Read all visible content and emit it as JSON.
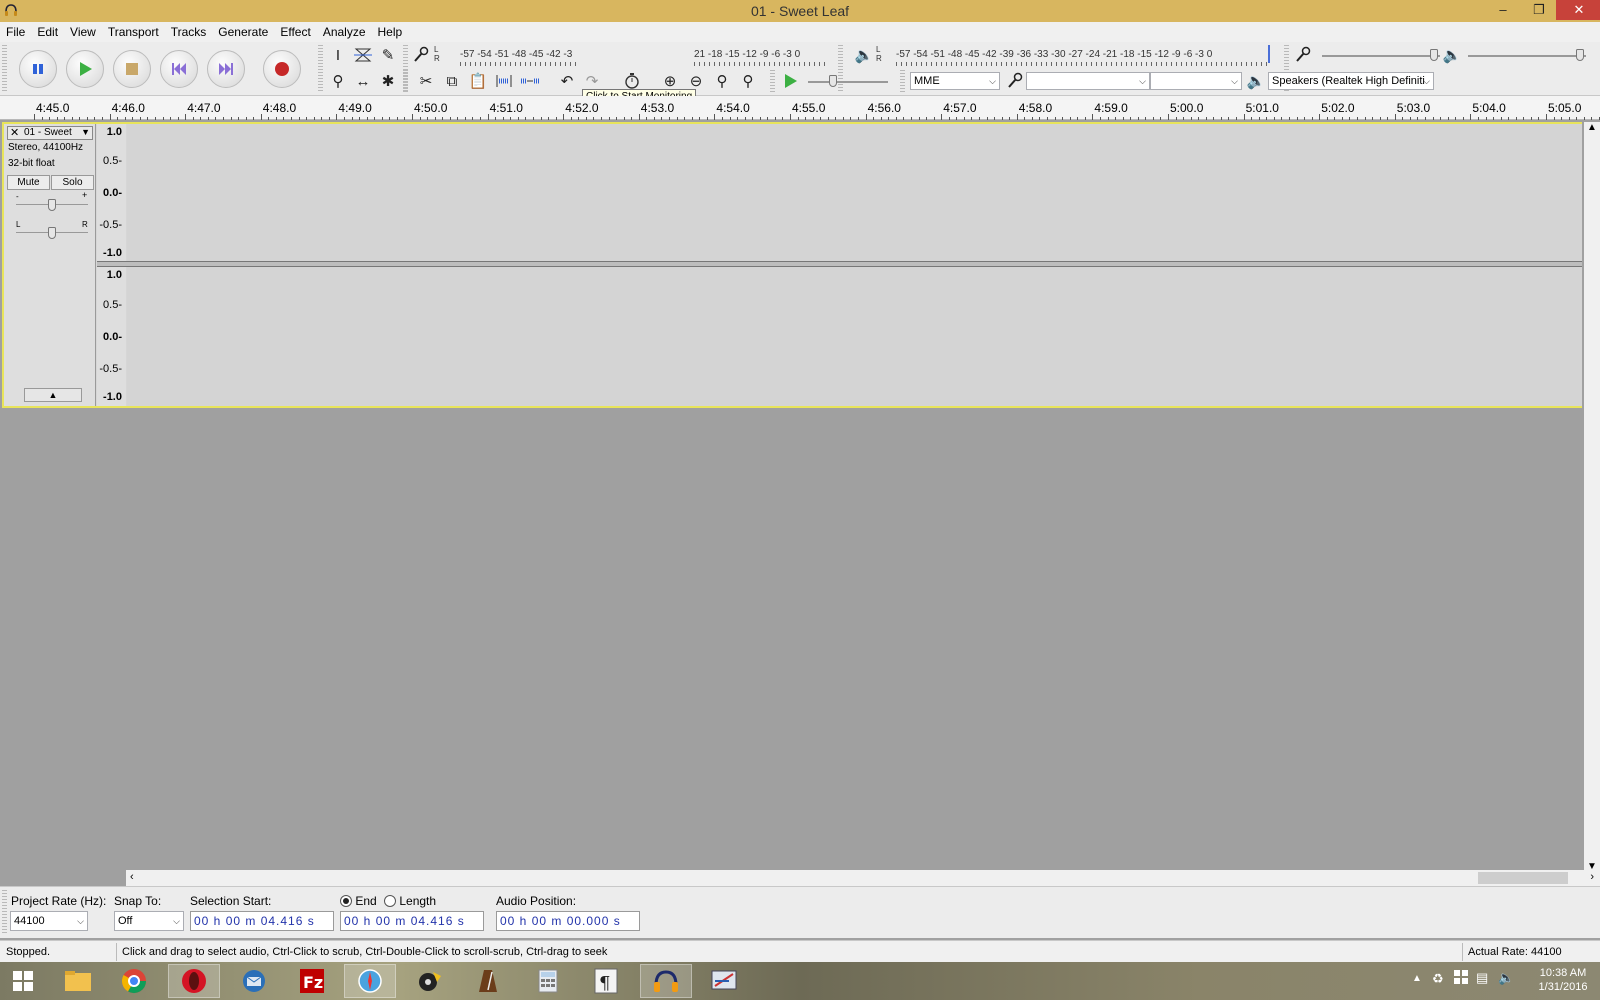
{
  "window": {
    "title": "01 - Sweet Leaf",
    "minimize": "–",
    "restore": "❐",
    "close": "✕"
  },
  "menu": [
    "File",
    "Edit",
    "View",
    "Transport",
    "Tracks",
    "Generate",
    "Effect",
    "Analyze",
    "Help"
  ],
  "meters": {
    "record_scale": "-57 -54 -51 -48 -45 -42 -3",
    "record_scale_right": "21 -18 -15 -12 -9 -6 -3 0",
    "record_lr": "L\nR",
    "tooltip": "Click to Start Monitoring",
    "playback_scale": "-57 -54 -51 -48 -45 -42 -39 -36 -33 -30 -27 -24 -21 -18 -15 -12 -9 -6 -3 0",
    "playback_lr": "L\nR"
  },
  "device": {
    "host": "MME",
    "input_device": "",
    "input_channels": "",
    "output_device": "Speakers (Realtek High Definiti"
  },
  "ruler": {
    "labels": [
      "4:45.0",
      "4:46.0",
      "4:47.0",
      "4:48.0",
      "4:49.0",
      "4:50.0",
      "4:51.0",
      "4:52.0",
      "4:53.0",
      "4:54.0",
      "4:55.0",
      "4:56.0",
      "4:57.0",
      "4:58.0",
      "4:59.0",
      "5:00.0",
      "5:01.0",
      "5:02.0",
      "5:03.0",
      "5:04.0",
      "5:05.0"
    ]
  },
  "track": {
    "name": "01 - Sweet",
    "format": "Stereo, 44100Hz",
    "bitdepth": "32-bit float",
    "mute": "Mute",
    "solo": "Solo",
    "gain_minus": "-",
    "gain_plus": "+",
    "pan_left": "L",
    "pan_right": "R",
    "scale": [
      "1.0",
      "0.5-",
      "0.0-",
      "-0.5-",
      "-1.0"
    ]
  },
  "selection": {
    "project_rate_label": "Project Rate (Hz):",
    "project_rate": "44100",
    "snap_label": "Snap To:",
    "snap_value": "Off",
    "start_label": "Selection Start:",
    "start_time": "00 h 00 m 04.416 s",
    "end_label": "End",
    "length_label": "Length",
    "end_time": "00 h 00 m 04.416 s",
    "position_label": "Audio Position:",
    "position_time": "00 h 00 m 00.000 s"
  },
  "status": {
    "state": "Stopped.",
    "hint": "Click and drag to select audio, Ctrl-Click to scrub, Ctrl-Double-Click to scroll-scrub, Ctrl-drag to seek",
    "actual_rate": "Actual Rate: 44100"
  },
  "taskbar": {
    "time": "10:38 AM",
    "date": "1/31/2016",
    "apps": [
      "file-explorer",
      "chrome",
      "opera",
      "thunderbird",
      "filezilla",
      "safari",
      "vlc-like",
      "metronome",
      "calculator",
      "pilcrow-editor",
      "audacity",
      "screen-tool"
    ]
  },
  "colors": {
    "titlebar": "#d8b65f",
    "track_border": "#e8e45a",
    "play_green": "#3cb043",
    "record_red": "#c62828",
    "pause_blue": "#2f62d8",
    "skip_purple": "#8a6fd6"
  }
}
